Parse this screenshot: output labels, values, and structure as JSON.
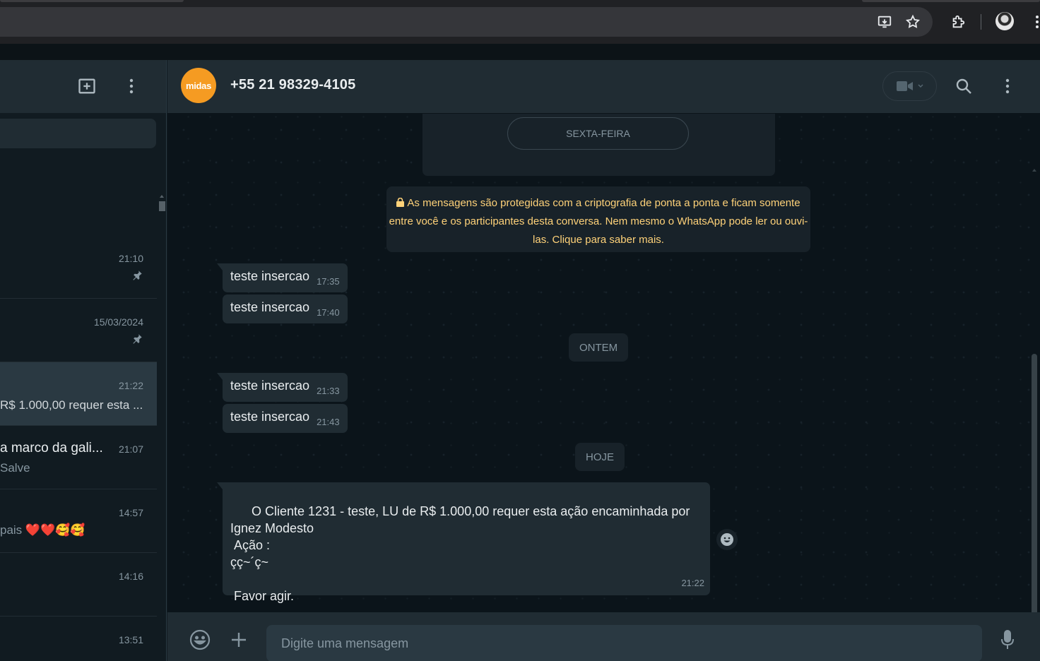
{
  "browser": {
    "icons": [
      "install-app-icon",
      "bookmark-star-icon",
      "extensions-icon",
      "profile-avatar",
      "more-menu-icon"
    ]
  },
  "sidebar": {
    "header_icons": [
      "new-chat-icon",
      "more-menu-icon"
    ],
    "chats": [
      {
        "time": "21:10",
        "pinned": true,
        "name": "",
        "preview": ""
      },
      {
        "time": "15/03/2024",
        "pinned": true,
        "name": "",
        "preview": ""
      },
      {
        "time": "21:22",
        "pinned": false,
        "name": "",
        "preview": "R$ 1.000,00 requer esta ...",
        "active": true
      },
      {
        "time": "21:07",
        "pinned": false,
        "name": "a marco da gali...",
        "preview": "Salve"
      },
      {
        "time": "14:57",
        "pinned": false,
        "name": "",
        "preview": "pais ❤️❤️🥰🥰"
      },
      {
        "time": "14:16",
        "pinned": false,
        "name": "",
        "preview": ""
      },
      {
        "time": "13:51",
        "pinned": false,
        "name": "",
        "preview": ""
      }
    ]
  },
  "conversation": {
    "avatar_text": "midas",
    "contact": "+55 21 98329-4105",
    "header_icons": [
      "video-call-icon",
      "search-icon",
      "more-menu-icon"
    ],
    "days": {
      "friday": "SEXTA-FEIRA",
      "yesterday": "ONTEM",
      "today": "HOJE"
    },
    "encryption_notice": "As mensagens são protegidas com a criptografia de ponta a ponta e ficam somente entre você e os participantes desta conversa. Nem mesmo o WhatsApp pode ler ou ouvi-las. Clique para saber mais.",
    "messages": [
      {
        "text": "teste insercao",
        "time": "17:35"
      },
      {
        "text": "teste insercao",
        "time": "17:40"
      },
      {
        "text": "teste insercao",
        "time": "21:33"
      },
      {
        "text": "teste insercao",
        "time": "21:43"
      }
    ],
    "long_message": {
      "text": "O Cliente 1231 - teste, LU de R$ 1.000,00 requer esta ação encaminhada por Ignez Modesto\n Ação :\nçç~´ç~\n\n Favor agir.",
      "time": "21:22"
    },
    "composer": {
      "placeholder": "Digite uma mensagem"
    }
  },
  "colors": {
    "accent": "#00a884",
    "notice": "#ffd279",
    "avatar": "#f59b22"
  }
}
